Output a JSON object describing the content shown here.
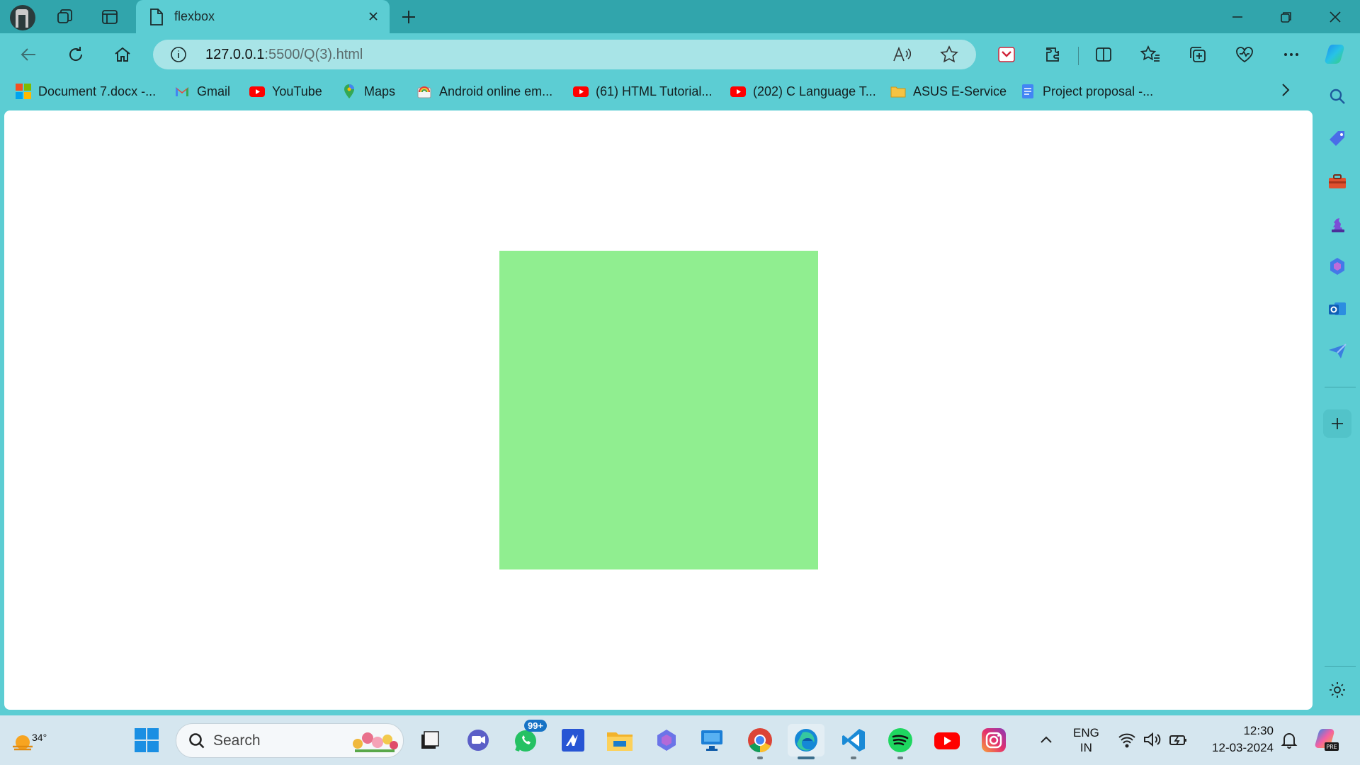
{
  "window": {
    "tab_title": "flexbox",
    "address_host": "127.0.0.1",
    "address_rest": ":5500/Q(3).html"
  },
  "bookmarks": [
    {
      "label": "Document 7.docx -...",
      "icon": "microsoft-icon"
    },
    {
      "label": "Gmail",
      "icon": "gmail-icon"
    },
    {
      "label": "YouTube",
      "icon": "youtube-icon"
    },
    {
      "label": "Maps",
      "icon": "maps-icon"
    },
    {
      "label": "Android online em...",
      "icon": "android-icon"
    },
    {
      "label": "(61) HTML Tutorial...",
      "icon": "youtube-icon"
    },
    {
      "label": "(202) C Language T...",
      "icon": "youtube-icon"
    },
    {
      "label": "ASUS E-Service",
      "icon": "folder-icon"
    },
    {
      "label": "Project proposal -...",
      "icon": "docs-icon"
    }
  ],
  "page": {
    "box_color": "#90ee90"
  },
  "taskbar": {
    "weather_temp": "34°",
    "search_placeholder": "Search",
    "whatsapp_badge": "99+",
    "lang_line1": "ENG",
    "lang_line2": "IN",
    "time": "12:30",
    "date": "12-03-2024"
  },
  "colors": {
    "titlebar": "#31a5ac",
    "toolbar": "#5ccdd3",
    "address_bar": "#a8e4e7",
    "taskbar": "#d5e6ef"
  }
}
